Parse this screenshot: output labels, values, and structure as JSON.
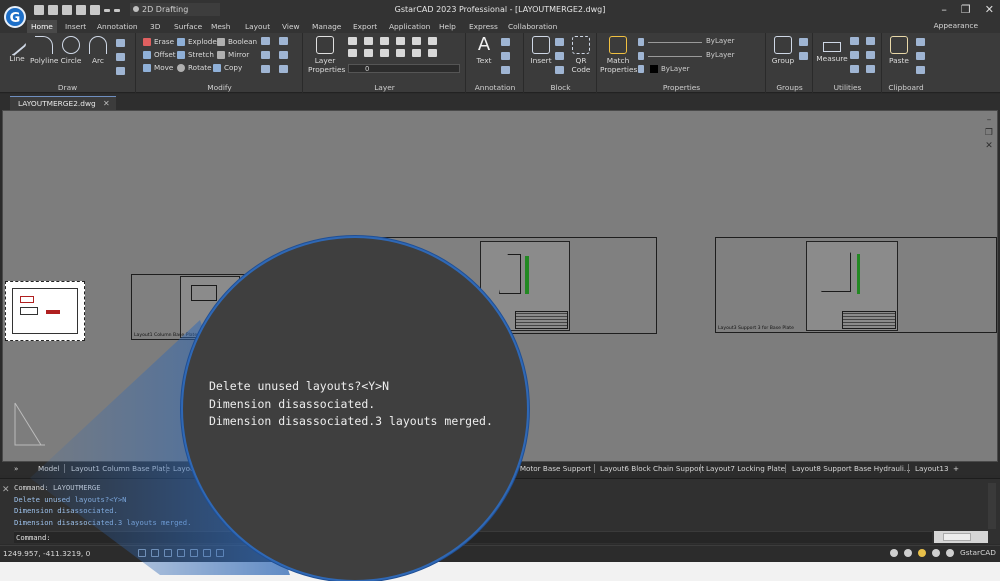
{
  "window": {
    "title": "GstarCAD 2023 Professional - [LAYOUTMERGE2.dwg]",
    "workspace": "2D Drafting",
    "appearance_label": "Appearance"
  },
  "ribbon_tabs": [
    "Home",
    "Insert",
    "Annotation",
    "3D",
    "Surface",
    "Mesh",
    "Layout",
    "View",
    "Manage",
    "Export",
    "Application",
    "Help",
    "Express",
    "Collaboration"
  ],
  "panels": {
    "draw": {
      "title": "Draw",
      "tools": [
        "Line",
        "Polyline",
        "Circle",
        "Arc"
      ]
    },
    "modify": {
      "title": "Modify",
      "tools": [
        "Erase",
        "Explode",
        "Boolean",
        "Offset",
        "Stretch",
        "Mirror",
        "Move",
        "Rotate",
        "Copy"
      ]
    },
    "layer": {
      "title": "Layer",
      "tool": "Layer Properties",
      "current_layer": "0"
    },
    "annotation": {
      "title": "Annotation",
      "tool": "Text"
    },
    "block": {
      "title": "Block",
      "tools": [
        "Insert",
        "QR Code"
      ]
    },
    "properties": {
      "title": "Properties",
      "tool": "Match Properties",
      "linetype": "ByLayer",
      "lineweight": "ByLayer",
      "color": "ByLayer"
    },
    "groups": {
      "title": "Groups",
      "tool": "Group"
    },
    "utilities": {
      "title": "Utilities",
      "tool": "Measure"
    },
    "clipboard": {
      "title": "Clipboard",
      "tool": "Paste"
    }
  },
  "document_tab": "LAYOUTMERGE2.dwg",
  "canvas": {
    "layouts": [
      {
        "name": "Layout1 Column Base Plate"
      },
      {
        "name": ""
      },
      {
        "name": "Layout3 Support 3 for Base Plate"
      }
    ]
  },
  "layout_tabs": [
    "Model",
    "Layout1 Column Base Plate",
    "Layout2",
    "Layout5 Motor Base Support",
    "Layout6 Block Chain Support",
    "Layout7 Locking Plate",
    "Layout8 Support Base Hydrauli...",
    "Layout13"
  ],
  "layout_tab_visible": {
    "layout2": "Layou",
    "layout5": "5 Motor Base Support"
  },
  "command": {
    "history": [
      "Command: LAYOUTMERGE",
      "Delete unused layouts?<Y>N",
      "Dimension disassociated.",
      "Dimension disassociated.3 layouts merged."
    ],
    "prompt": "Command:"
  },
  "status": {
    "coordinates": "1249.957, -411.3219, 0",
    "brand": "GstarCAD"
  },
  "magnifier": {
    "lines": [
      "Delete unused layouts?<Y>N",
      "Dimension disassociated.",
      "Dimension disassociated.3 layouts merged."
    ]
  },
  "colors": {
    "accent": "#2f68b5",
    "canvas": "#7d7d7d",
    "logo": "#1d6fc8"
  }
}
